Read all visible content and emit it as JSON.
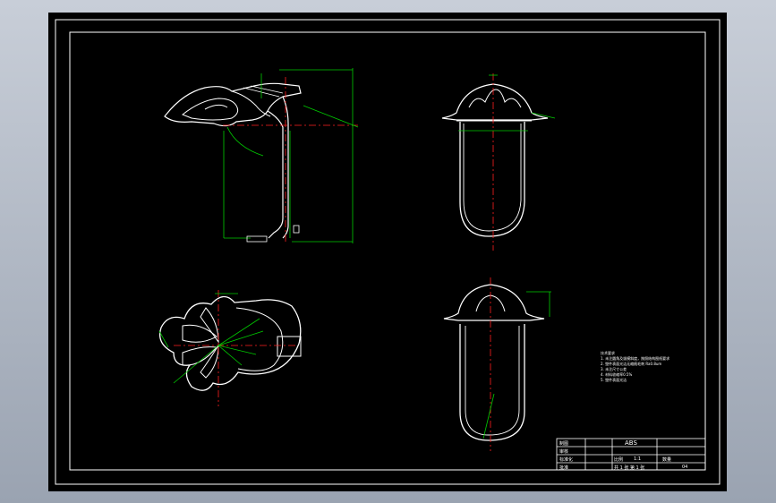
{
  "notes": {
    "title": "技术要求",
    "lines": [
      "1. 未注圆角及拔模斜度，按照结构图纸要求",
      "2. 塑件表面光洁无缩痕毛刺 Ra0.8um",
      "3. 未注尺寸公差",
      "4. 材料收缩率0.5%",
      "5. 塑件表面光洁"
    ]
  },
  "title_block": {
    "material": "ABS",
    "scale_label": "比例",
    "scale_value": "1:1",
    "qty_label": "数量",
    "sheet_info": "共 1 张 第 1 张",
    "part_code": "04",
    "drawn": "制图",
    "checked": "审核",
    "standard": "标准化",
    "approved": "批准"
  },
  "colors": {
    "background": "#000000",
    "outline": "#ffffff",
    "dimension": "#00cc00",
    "centerline": "#ff2020"
  }
}
